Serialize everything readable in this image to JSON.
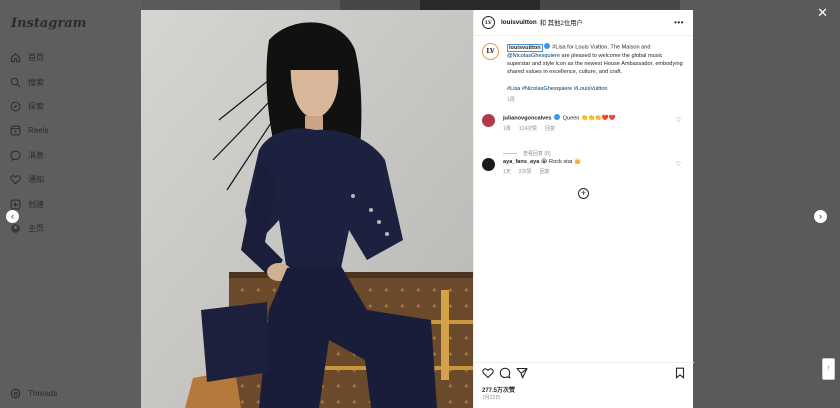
{
  "app": {
    "logo": "Instagram"
  },
  "nav": [
    {
      "label": "首页",
      "icon": "home-icon"
    },
    {
      "label": "搜索",
      "icon": "search-icon"
    },
    {
      "label": "探索",
      "icon": "compass-icon"
    },
    {
      "label": "Reels",
      "icon": "reels-icon"
    },
    {
      "label": "消息",
      "icon": "messenger-icon"
    },
    {
      "label": "通知",
      "icon": "heart-icon"
    },
    {
      "label": "创建",
      "icon": "plus-square-icon"
    },
    {
      "label": "主页",
      "icon": "profile-icon"
    },
    {
      "label": "Threads",
      "icon": "threads-icon"
    }
  ],
  "post": {
    "author": "louisvuitton",
    "header_suffix": "和 其他2位用户",
    "avatar_text": "LV",
    "caption": {
      "user": "louisvuitton",
      "part1": " #Lisa for Louis Vuitton. The Maison and ",
      "mention": "@NicolasGhesquiere",
      "part2": " are pleased to welcome the global music superstar and style icon as the newest House Ambassador, embodying shared values in excellence, culture, and craft.",
      "tags": "#Lisa #NicolasGhesquiere #LouisVuitton",
      "time": "1周"
    },
    "comments": [
      {
        "user": "julianovgoncalves",
        "text": "Queen 👏👏👏❤️❤️",
        "meta": [
          "1周",
          "124次赞",
          "回复"
        ],
        "avatar_color": "#b23a48"
      },
      {
        "user": "aya_fans_aya",
        "text": "😭 Rock star 👑",
        "meta": [
          "1天",
          "2次赞",
          "回复"
        ],
        "avatar_color": "#1b1b1b"
      }
    ],
    "view_replies": "查看回复 (8)",
    "likes": "277.5万次赞",
    "date": "7月22日"
  },
  "ui": {
    "close": "✕",
    "prev": "‹",
    "next": "›",
    "scroll_tab": "↑"
  }
}
